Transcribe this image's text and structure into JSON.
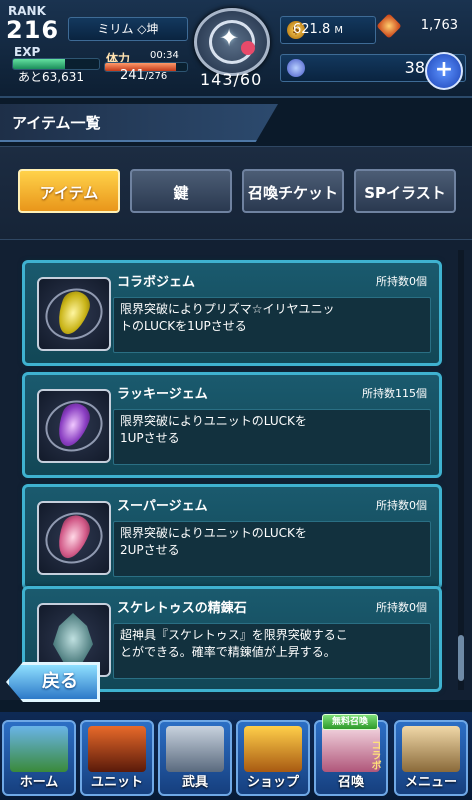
{
  "status": {
    "rank_label": "RANK",
    "rank_value": "216",
    "player_name": "ミリム ◇坤",
    "exp_label": "EXP",
    "exp_remaining": "あと63,631",
    "exp_progress": 0.6,
    "stamina_label": "体力",
    "stamina_timer": "00:34",
    "stamina_current": "241",
    "stamina_max": "/276",
    "stamina_progress": 0.87,
    "medal_stamina": "143/60",
    "coins_value": "621.8",
    "coins_unit": "M",
    "ore_value": "1,763",
    "orbs_value": "38"
  },
  "title": "アイテム一覧",
  "tabs": [
    {
      "label": "アイテム",
      "active": true
    },
    {
      "label": "鍵",
      "active": false
    },
    {
      "label": "召喚チケット",
      "active": false
    },
    {
      "label": "SPイラスト",
      "active": false
    }
  ],
  "items": [
    {
      "name": "コラボジェム",
      "count": "所持数0個",
      "desc_line1": "限界突破によりプリズマ☆イリヤユニッ",
      "desc_line2": "トのLUCKを1UPさせる",
      "icon": "yellow-gem-icon"
    },
    {
      "name": "ラッキージェム",
      "count": "所持数115個",
      "desc_line1": "限界突破によりユニットのLUCKを",
      "desc_line2": "1UPさせる",
      "icon": "purple-gem-icon"
    },
    {
      "name": "スーパージェム",
      "count": "所持数0個",
      "desc_line1": "限界突破によりユニットのLUCKを",
      "desc_line2": "2UPさせる",
      "icon": "pink-gem-icon"
    },
    {
      "name": "スケレトゥスの精錬石",
      "count": "所持数0個",
      "desc_line1": "超神具『スケレトゥス』を限界突破するこ",
      "desc_line2": "とができる。確率で精錬値が上昇する。",
      "icon": "skeletus-stone-icon"
    }
  ],
  "back_label": "戻る",
  "nav": {
    "home": "ホーム",
    "unit": "ユニット",
    "equip": "武具",
    "shop": "ショップ",
    "summon": "召喚",
    "summon_tag": "無料召喚",
    "summon_side": "コラボ",
    "menu": "メニュー"
  }
}
